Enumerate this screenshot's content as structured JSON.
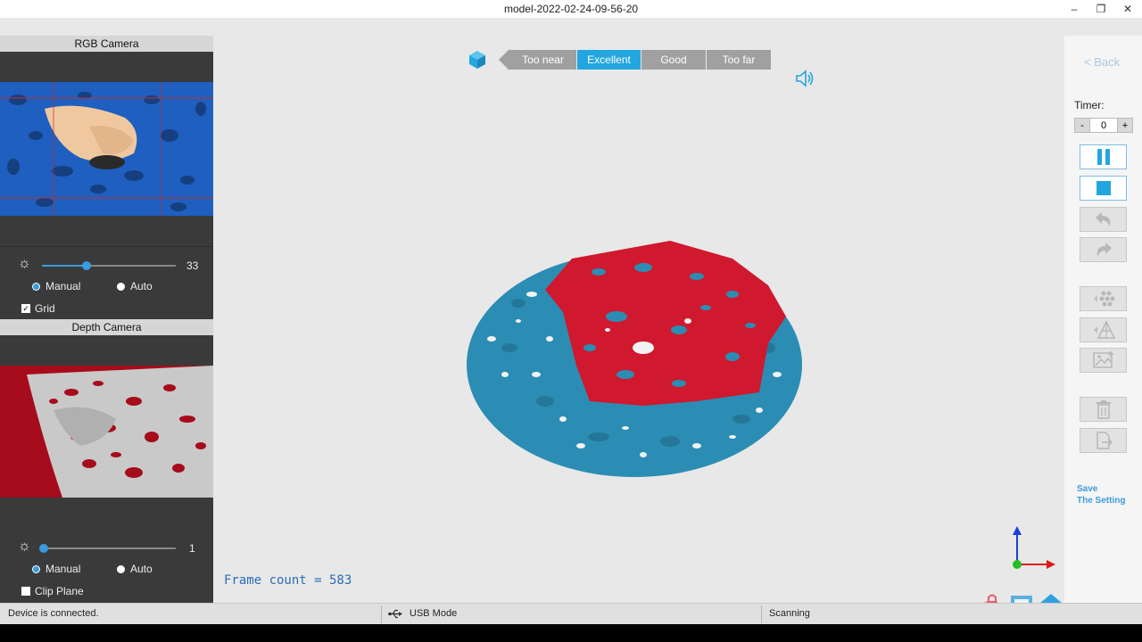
{
  "window": {
    "title": "model-2022-02-24-09-56-20",
    "minimize": "–",
    "maximize": "❐",
    "close": "✕"
  },
  "rgb_camera": {
    "header": "RGB Camera",
    "brightness_value": "33",
    "brightness_level": 0.33,
    "mode_manual": "Manual",
    "mode_auto": "Auto",
    "selected_mode": "Manual",
    "grid_label": "Grid",
    "grid_checked": true
  },
  "depth_camera": {
    "header": "Depth Camera",
    "brightness_value": "1",
    "brightness_level": 0.01,
    "mode_manual": "Manual",
    "mode_auto": "Auto",
    "selected_mode": "Manual",
    "clip_plane_label": "Clip Plane",
    "clip_plane_checked": false
  },
  "distance_indicator": {
    "segments": [
      "Too near",
      "Excellent",
      "Good",
      "Too far"
    ],
    "active": "Excellent"
  },
  "viewport": {
    "frame_count_text": "Frame count = 583"
  },
  "right_panel": {
    "back_label": "< Back",
    "timer_label": "Timer:",
    "timer_minus": "-",
    "timer_value": "0",
    "timer_plus": "+",
    "save_line1": "Save",
    "save_line2": "The Setting"
  },
  "status_bar": {
    "connection": "Device is connected.",
    "mode": "USB Mode",
    "state": "Scanning"
  },
  "colors": {
    "accent": "#23a6e0",
    "scan_blue": "#2b8db3",
    "scan_red": "#d0182e"
  }
}
